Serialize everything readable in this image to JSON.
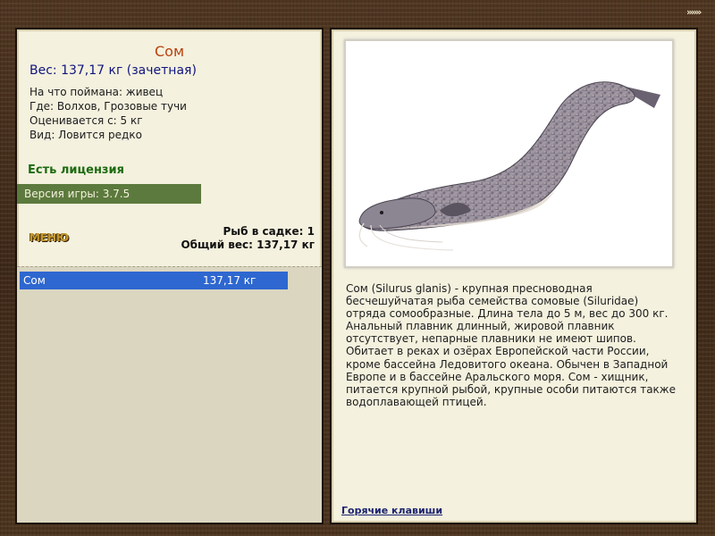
{
  "header": {
    "more_icon": "»»»"
  },
  "fish": {
    "name": "Сом",
    "weight": "Вес: 137,17 кг (зачетная)",
    "bait": "На что поймана: живец",
    "location": "Где: Волхов, Грозовые тучи",
    "min_weight": "Оценивается с: 5 кг",
    "rarity": "Вид: Ловится редко",
    "image_icon": "catfish-image",
    "description": "Сом (Silurus glanis) - крупная пресноводная бесчешуйчатая рыба семейства сомовые (Siluridae) отряда сомообразные. Длина тела до 5 м, вес до 300 кг. Анальный плавник длинный, жировой плавник отсутствует, непарные плавники не имеют шипов. Обитает в реках и озёрах Европейской части России, кроме бассейна Ледовитого океана. Обычен в Западной Европе и в бассейне Аральского моря. Сом - хищник, питается крупной рыбой, крупные особи питаются также водоплавающей птицей."
  },
  "license": "Есть лицензия",
  "version": "Версия игры: 3.7.5",
  "menu_label": "МЕНЮ",
  "keepnet": {
    "count_label": "Рыб в садке: 1",
    "total_label": "Общий вес: 137,17 кг"
  },
  "catch_list": [
    {
      "name": "Сом",
      "weight": "137,17 кг"
    }
  ],
  "hotkeys_label": "Горячие клавиши",
  "colors": {
    "title": "#b8410e",
    "weight": "#10157e",
    "license": "#1d6b12",
    "version_bar": "#5c7a3d",
    "selection": "#2e67cf",
    "panel": "#f4f1de",
    "background": "#3d2817"
  }
}
